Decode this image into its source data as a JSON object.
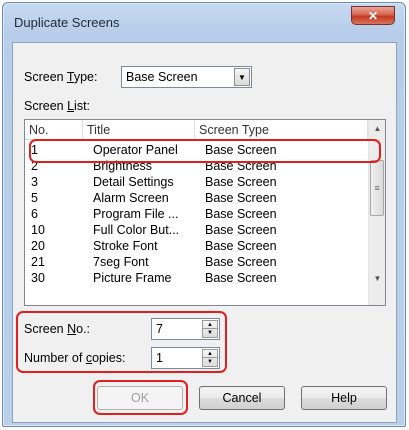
{
  "window": {
    "title": "Duplicate Screens",
    "close_glyph": "✕"
  },
  "screen_type": {
    "label_pre": "Screen ",
    "label_key": "T",
    "label_post": "ype:",
    "value": "Base Screen"
  },
  "screen_list": {
    "label_pre": "Screen ",
    "label_key": "L",
    "label_post": "ist:",
    "columns": [
      "No.",
      "Title",
      "Screen Type"
    ],
    "rows": [
      {
        "no": "1",
        "title": "Operator Panel",
        "type": "Base Screen"
      },
      {
        "no": "2",
        "title": "Brightness",
        "type": "Base Screen"
      },
      {
        "no": "3",
        "title": "Detail Settings",
        "type": "Base Screen"
      },
      {
        "no": "5",
        "title": "Alarm Screen",
        "type": "Base Screen"
      },
      {
        "no": "6",
        "title": "Program File ...",
        "type": "Base Screen"
      },
      {
        "no": "10",
        "title": "Full Color But...",
        "type": "Base Screen"
      },
      {
        "no": "20",
        "title": "Stroke Font",
        "type": "Base Screen"
      },
      {
        "no": "21",
        "title": "7seg Font",
        "type": "Base Screen"
      },
      {
        "no": "30",
        "title": "Picture Frame",
        "type": "Base Screen"
      }
    ]
  },
  "screen_no": {
    "label_pre": "Screen ",
    "label_key": "N",
    "label_post": "o.:",
    "value": "7"
  },
  "copies": {
    "label_pre": "Number of ",
    "label_key": "c",
    "label_post": "opies:",
    "value": "1"
  },
  "buttons": {
    "ok": "OK",
    "cancel": "Cancel",
    "help": "Help"
  },
  "colors": {
    "highlight": "#e02020",
    "window_frame": "#b9cfea"
  },
  "icons": {
    "dropdown": "chevron-down-icon",
    "spin_up": "spin-up-icon",
    "spin_down": "spin-down-icon"
  }
}
